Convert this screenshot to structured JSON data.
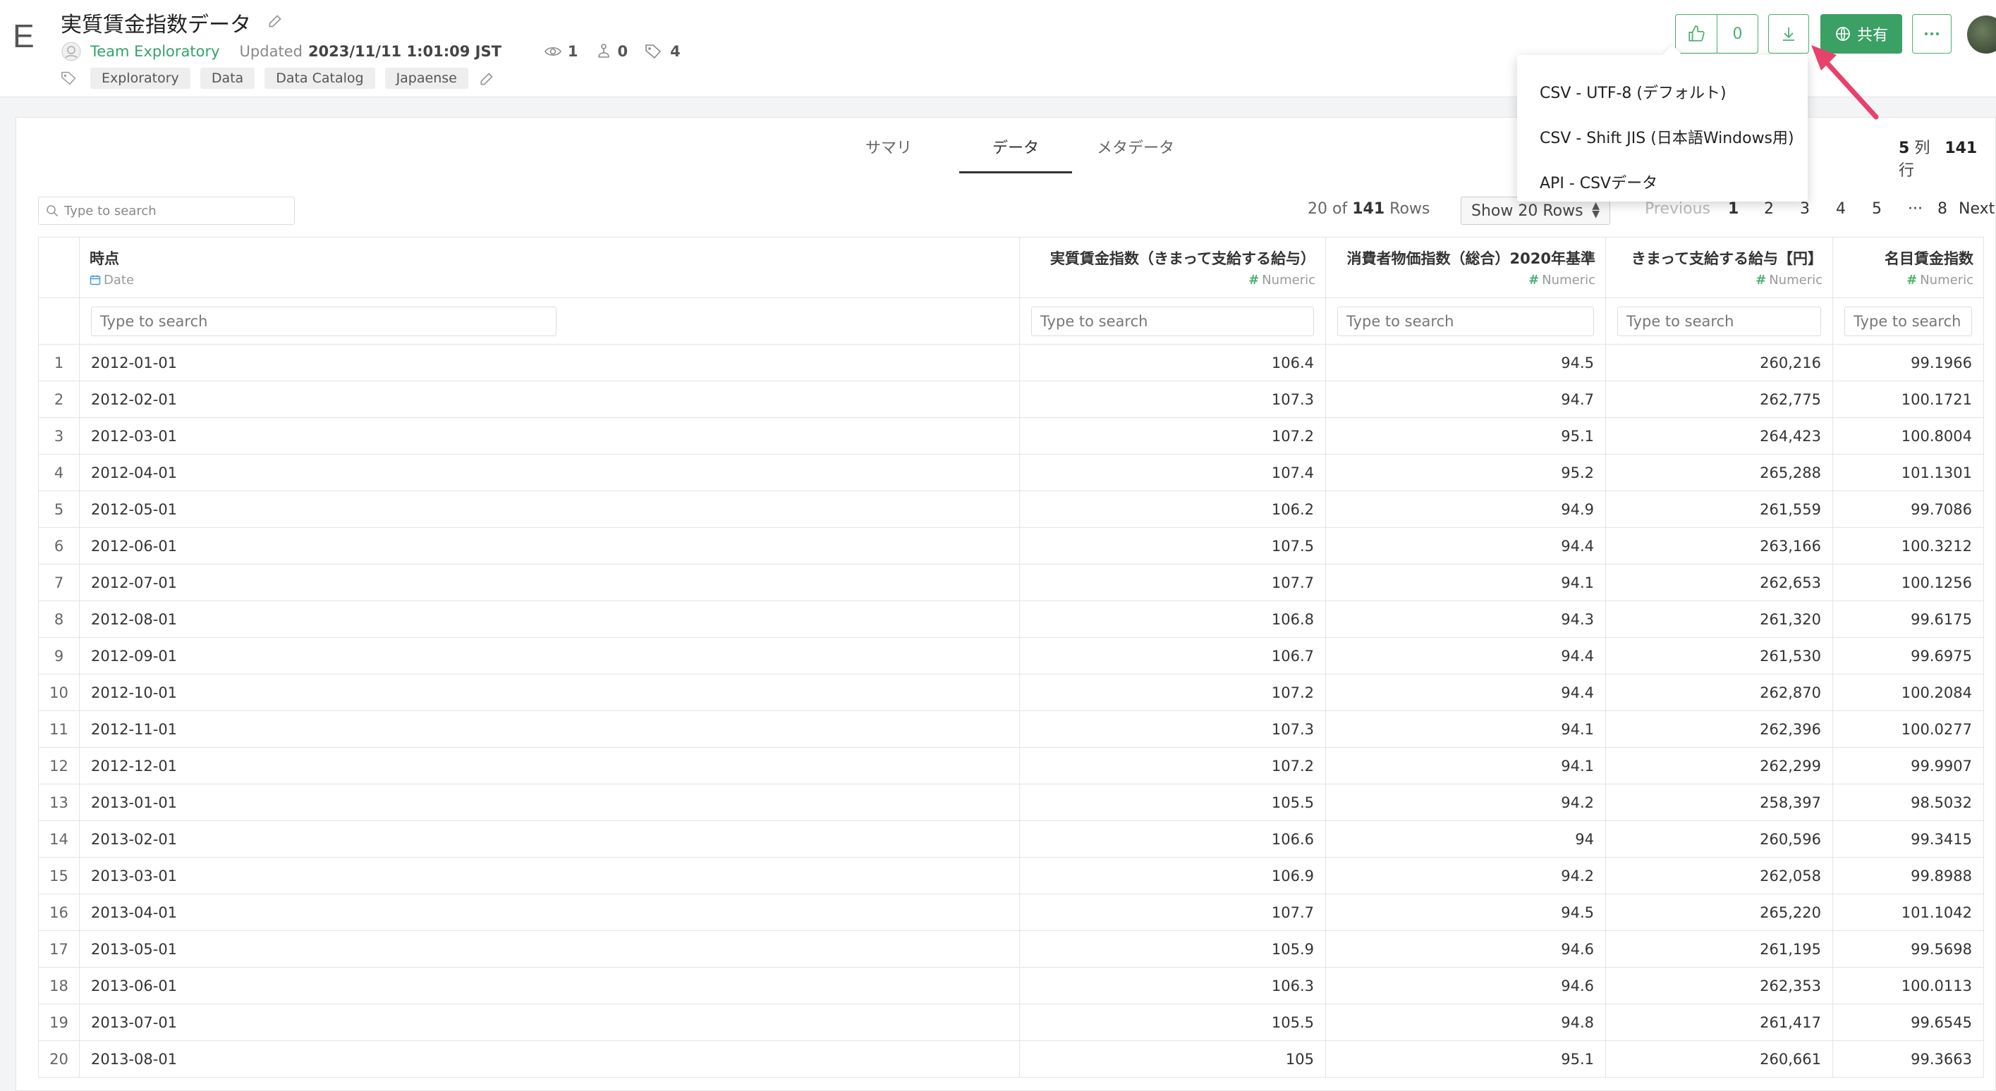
{
  "app": {
    "logo": "E"
  },
  "header": {
    "title": "実質賃金指数データ",
    "team": "Team Exploratory",
    "updated_label": "Updated",
    "updated_value": "2023/11/11 1:01:09 JST",
    "views": "1",
    "forks": "0",
    "tag_count": "4",
    "tags": [
      "Exploratory",
      "Data",
      "Data Catalog",
      "Japaense"
    ],
    "like_count": "0",
    "share_label": "共有"
  },
  "download_menu": {
    "items": [
      "CSV - UTF-8 (デフォルト)",
      "CSV - Shift JIS (日本語Windows用)",
      "API - CSVデータ"
    ]
  },
  "tabs": [
    "サマリ",
    "データ",
    "メタデータ"
  ],
  "active_tab": "データ",
  "dims": {
    "cols": "5",
    "cols_unit": "列",
    "rows": "141",
    "rows_unit": "行"
  },
  "toolbar": {
    "search_placeholder": "Type to search",
    "rows_shown": "20",
    "rows_of": "of",
    "rows_total": "141",
    "rows_label": "Rows",
    "show_rows": "Show 20 Rows",
    "pager": {
      "prev": "Previous",
      "pages": [
        "1",
        "2",
        "3",
        "4",
        "5"
      ],
      "dots": "···",
      "last": "8",
      "next": "Next",
      "current": "1"
    }
  },
  "table": {
    "columns": [
      {
        "name": "時点",
        "type": "Date"
      },
      {
        "name": "実質賃金指数（きまって支給する給与）",
        "type": "Numeric"
      },
      {
        "name": "消費者物価指数（総合）2020年基準",
        "type": "Numeric"
      },
      {
        "name": "きまって支給する給与【円】",
        "type": "Numeric"
      },
      {
        "name": "名目賃金指数",
        "type": "Numeric"
      }
    ],
    "filter_placeholder": "Type to search",
    "rows": [
      [
        "1",
        "2012-01-01",
        "106.4",
        "94.5",
        "260,216",
        "99.1966"
      ],
      [
        "2",
        "2012-02-01",
        "107.3",
        "94.7",
        "262,775",
        "100.1721"
      ],
      [
        "3",
        "2012-03-01",
        "107.2",
        "95.1",
        "264,423",
        "100.8004"
      ],
      [
        "4",
        "2012-04-01",
        "107.4",
        "95.2",
        "265,288",
        "101.1301"
      ],
      [
        "5",
        "2012-05-01",
        "106.2",
        "94.9",
        "261,559",
        "99.7086"
      ],
      [
        "6",
        "2012-06-01",
        "107.5",
        "94.4",
        "263,166",
        "100.3212"
      ],
      [
        "7",
        "2012-07-01",
        "107.7",
        "94.1",
        "262,653",
        "100.1256"
      ],
      [
        "8",
        "2012-08-01",
        "106.8",
        "94.3",
        "261,320",
        "99.6175"
      ],
      [
        "9",
        "2012-09-01",
        "106.7",
        "94.4",
        "261,530",
        "99.6975"
      ],
      [
        "10",
        "2012-10-01",
        "107.2",
        "94.4",
        "262,870",
        "100.2084"
      ],
      [
        "11",
        "2012-11-01",
        "107.3",
        "94.1",
        "262,396",
        "100.0277"
      ],
      [
        "12",
        "2012-12-01",
        "107.2",
        "94.1",
        "262,299",
        "99.9907"
      ],
      [
        "13",
        "2013-01-01",
        "105.5",
        "94.2",
        "258,397",
        "98.5032"
      ],
      [
        "14",
        "2013-02-01",
        "106.6",
        "94",
        "260,596",
        "99.3415"
      ],
      [
        "15",
        "2013-03-01",
        "106.9",
        "94.2",
        "262,058",
        "99.8988"
      ],
      [
        "16",
        "2013-04-01",
        "107.7",
        "94.5",
        "265,220",
        "101.1042"
      ],
      [
        "17",
        "2013-05-01",
        "105.9",
        "94.6",
        "261,195",
        "99.5698"
      ],
      [
        "18",
        "2013-06-01",
        "106.3",
        "94.6",
        "262,353",
        "100.0113"
      ],
      [
        "19",
        "2013-07-01",
        "105.5",
        "94.8",
        "261,417",
        "99.6545"
      ],
      [
        "20",
        "2013-08-01",
        "105",
        "95.1",
        "260,661",
        "99.3663"
      ]
    ]
  },
  "colors": {
    "accent": "#48b071",
    "share": "#3aa064",
    "arrow": "#e8416b"
  }
}
